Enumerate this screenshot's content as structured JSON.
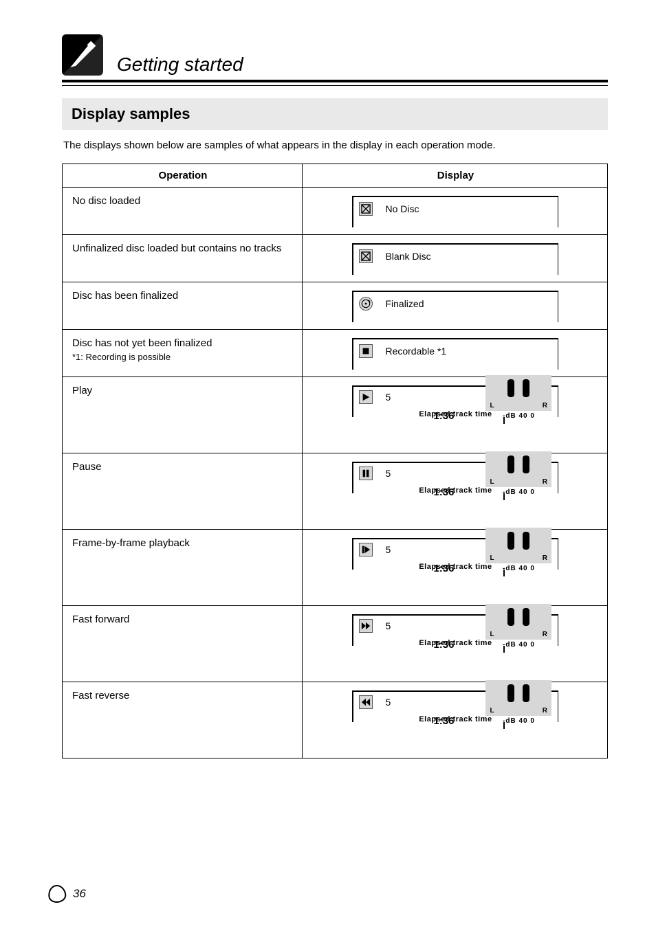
{
  "header": {
    "title": "Getting started"
  },
  "section": {
    "heading": "Display samples",
    "intro": "The displays shown below are samples of what appears in the display in each operation mode."
  },
  "table": {
    "col1": "Operation",
    "col2": "Display",
    "rows": [
      {
        "op_label": "No disc loaded",
        "note": "",
        "disp": {
          "type": "simple",
          "icon": "nodisc",
          "text": "No Disc"
        }
      },
      {
        "op_label": "Unfinalized disc loaded but contains no tracks",
        "note": "",
        "disp": {
          "type": "simple",
          "icon": "nodisc",
          "text": "Blank Disc"
        }
      },
      {
        "op_label": "Disc has been finalized",
        "note": "",
        "disp": {
          "type": "simple",
          "icon": "finalized",
          "text": "Finalized"
        }
      },
      {
        "op_label": "Disc has not yet been finalized",
        "note": "*1: Recording is possible",
        "disp": {
          "type": "simple",
          "icon": "stop",
          "text": "Recordable *1"
        }
      },
      {
        "op_label": "Play",
        "note": "",
        "disp": {
          "type": "transport",
          "icon": "play",
          "track": "5",
          "time": "1:36",
          "caption": "Elapsed track time",
          "levels": {
            "l": "L",
            "r": "R",
            "neg": "-dB  40     0"
          },
          "timecode": "1:36"
        }
      },
      {
        "op_label": "Pause",
        "note": "",
        "disp": {
          "type": "transport",
          "icon": "pause",
          "track": "5",
          "time": "1:36",
          "caption": "Elapsed track time",
          "levels": {
            "l": "L",
            "r": "R",
            "neg": "-dB  40     0"
          },
          "timecode": "1:36"
        }
      },
      {
        "op_label": "Frame-by-frame playback",
        "note": "",
        "disp": {
          "type": "transport",
          "icon": "frame",
          "track": "5",
          "time": "1:36",
          "caption": "Elapsed track time",
          "levels": {
            "l": "L",
            "r": "R",
            "neg": "-dB  40     0"
          },
          "timecode": "1:36"
        }
      },
      {
        "op_label": "Fast forward",
        "note": "",
        "disp": {
          "type": "transport",
          "icon": "ffwd",
          "track": "5",
          "time": "1:36",
          "caption": "Elapsed track time",
          "levels": {
            "l": "L",
            "r": "R",
            "neg": "-dB  40     0"
          },
          "timecode": "1:36"
        }
      },
      {
        "op_label": "Fast reverse",
        "note": "",
        "disp": {
          "type": "transport",
          "icon": "frev",
          "track": "5",
          "time": "1:36",
          "caption": "Elapsed track time",
          "levels": {
            "l": "L",
            "r": "R",
            "neg": "-dB  40     0"
          },
          "timecode": "1:36"
        }
      }
    ]
  },
  "page_number": "36"
}
